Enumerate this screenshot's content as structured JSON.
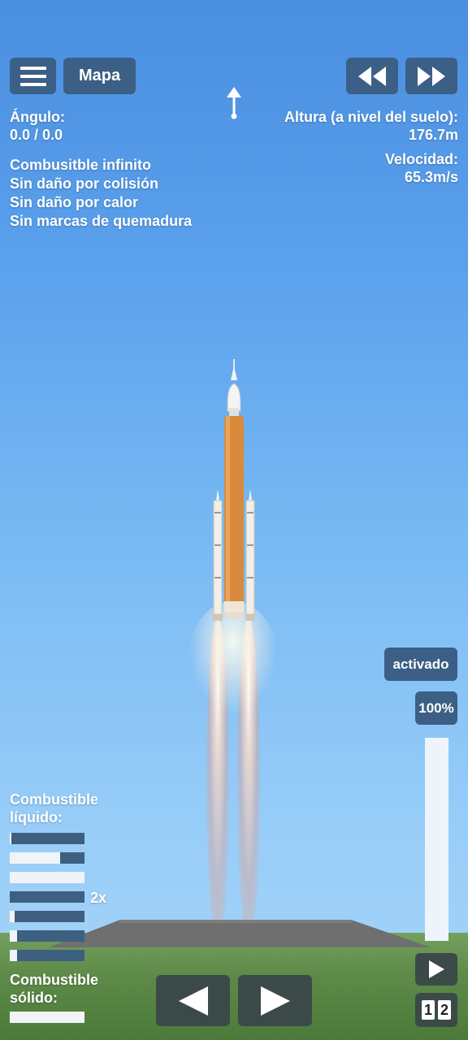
{
  "toolbar": {
    "menu_icon": "hamburger-menu-icon",
    "map_label": "Mapa",
    "rewind_icon": "rewind-icon",
    "fast_forward_icon": "fast-forward-icon"
  },
  "heading_indicator_icon": "up-arrow-icon",
  "angle": {
    "label": "Ángulo:",
    "value": "0.0 / 0.0"
  },
  "cheats": [
    "Combusitble infinito",
    "Sin daño por colisión",
    "Sin daño por calor",
    "Sin marcas de quemadura"
  ],
  "altitude": {
    "label": "Altura (a nivel del suelo):",
    "value": "176.7m"
  },
  "velocity": {
    "label": "Velocidad:",
    "value": "65.3m/s"
  },
  "throttle": {
    "activated_label": "activado",
    "percent_label": "100%",
    "level": 1.0
  },
  "liquid_fuel": {
    "label_line1": "Combustible",
    "label_line2": "líquido:",
    "tanks": [
      0.98,
      0.33,
      0.0,
      1.0,
      0.93,
      0.9,
      0.9
    ],
    "multiplier": "2x"
  },
  "solid_fuel": {
    "label_line1": "Combustible",
    "label_line2": "sólido:",
    "tanks": [
      0.0
    ]
  },
  "controls": {
    "rotate_left_icon": "left-triangle-icon",
    "rotate_right_icon": "right-triangle-icon",
    "play_icon": "play-icon",
    "stage_numbers": [
      "1",
      "2"
    ]
  },
  "colors": {
    "button": "#3c5f86",
    "dark_button": "#3b4a48",
    "fuel_bar_fill": "#3d5f80",
    "fuel_bar_empty": "#f0f4f8",
    "core_stage": "#d98a3c"
  }
}
